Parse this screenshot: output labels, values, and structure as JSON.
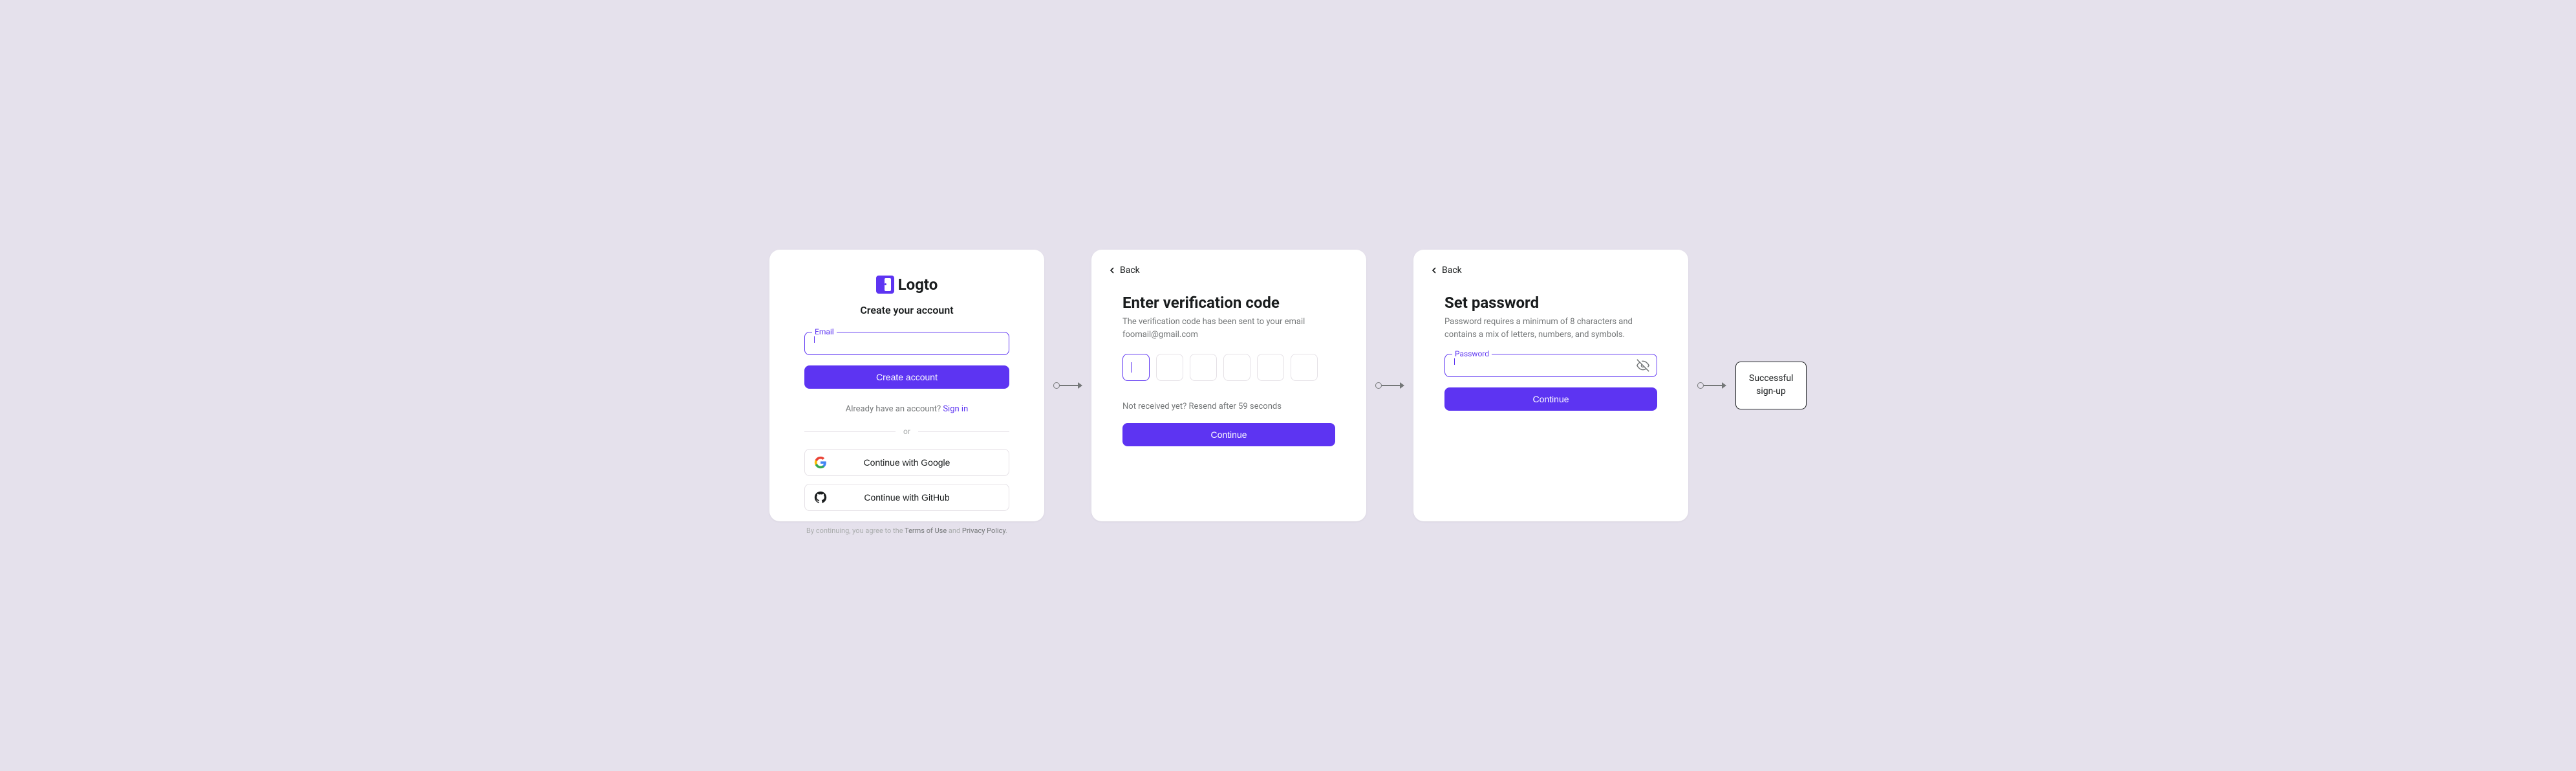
{
  "card1": {
    "logo_text": "Logto",
    "subtitle": "Create your account",
    "email_label": "Email",
    "create_btn": "Create account",
    "signin_prompt": "Already have an account? ",
    "signin_link": "Sign in",
    "divider": "or",
    "google_btn": "Continue with Google",
    "github_btn": "Continue with GitHub",
    "terms_prefix": "By continuing, you agree to the ",
    "terms_link": "Terms of Use",
    "terms_and": " and ",
    "privacy_link": "Privacy Policy",
    "terms_suffix": "."
  },
  "card2": {
    "back": "Back",
    "heading": "Enter verification code",
    "desc_line1": "The verification code has been sent to your email",
    "desc_line2": "foomail@gmail.com",
    "resend": "Not received yet? Resend after 59 seconds",
    "continue_btn": "Continue"
  },
  "card3": {
    "back": "Back",
    "heading": "Set password",
    "desc": "Password requires a minimum of 8 characters and contains a mix of letters, numbers, and symbols.",
    "password_label": "Password",
    "continue_btn": "Continue"
  },
  "success": {
    "line1": "Successful",
    "line2": "sign-up"
  }
}
